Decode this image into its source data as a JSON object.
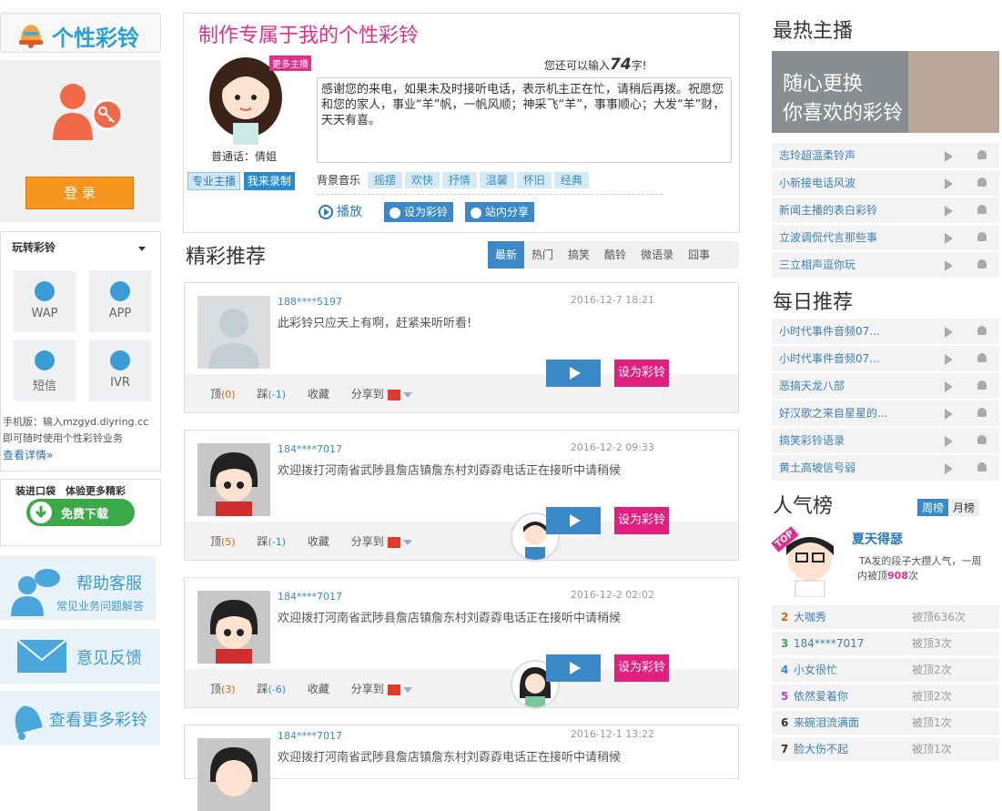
{
  "brand": {
    "title": "个性彩铃"
  },
  "left": {
    "login": "登 录",
    "play_title": "玩转彩铃",
    "channels": [
      "WAP",
      "APP",
      "短信",
      "IVR"
    ],
    "mobile_line1": "手机版：输入mzgyd.diyring.cc",
    "mobile_line2": "即可随时使用个性彩铃业务",
    "detail_link": "查看详情»",
    "pocket": "装进口袋　体验更多精彩",
    "download": "免费下载",
    "help_title": "帮助客服",
    "help_sub": "常见业务问题解答",
    "feedback": "意见反馈",
    "more": "查看更多彩铃"
  },
  "maker": {
    "title": "制作专属于我的个性彩铃",
    "more_anchor": "更多主播",
    "anchor_caption": "普通话：倩姐",
    "remain_prefix": "您还可以输入",
    "remain_count": "74",
    "remain_suffix": "字!",
    "text": "感谢您的来电，如果未及时接听电话，表示机主正在忙，请稍后再拨。祝愿您和您的家人，事业“羊”帆，一帆风顺；神采飞“羊”，事事顺心；大发“羊”财，天天有喜。",
    "tab_pro": "专业主播",
    "tab_self": "我来录制",
    "bg_label": "背景音乐",
    "bg_tags": [
      "摇摆",
      "欢快",
      "抒情",
      "温馨",
      "怀旧",
      "经典"
    ],
    "play": "播放",
    "set_ring": "设为彩铃",
    "share": "站内分享"
  },
  "recommend": {
    "title": "精彩推荐",
    "tabs": [
      "最新",
      "热门",
      "搞笑",
      "酷铃",
      "微语录",
      "囧事"
    ],
    "cards": [
      {
        "user": "188****5197",
        "time": "2016-12-7 18:21",
        "msg": "此彩铃只应天上有啊，赶紧来听听看!",
        "up": "顶",
        "up_n": "(0)",
        "down": "踩",
        "down_n": "(-1)",
        "fav": "收藏",
        "share": "分享到",
        "set": "设为彩铃"
      },
      {
        "user": "184****7017",
        "time": "2016-12-2 09:33",
        "msg": "欢迎拨打河南省武陟县詹店镇詹东村刘孬孬电话正在接听中请稍候",
        "up": "顶",
        "up_n": "(5)",
        "down": "踩",
        "down_n": "(-1)",
        "fav": "收藏",
        "share": "分享到",
        "set": "设为彩铃"
      },
      {
        "user": "184****7017",
        "time": "2016-12-2 02:02",
        "msg": "欢迎拨打河南省武陟县詹店镇詹东村刘孬孬电话正在接听中请稍候",
        "up": "顶",
        "up_n": "(3)",
        "down": "踩",
        "down_n": "(-6)",
        "fav": "收藏",
        "share": "分享到",
        "set": "设为彩铃"
      },
      {
        "user": "184****7017",
        "time": "2016-12-1 13:22",
        "msg": "欢迎拨打河南省武陟县詹店镇詹东村刘孬孬电话正在接听中请稍候"
      }
    ]
  },
  "right": {
    "hot_title": "最热主播",
    "banner_line1": "随心更换",
    "banner_line2": "你喜欢的彩铃",
    "hot_list": [
      "志玲超温柔铃声",
      "小新接电话风波",
      "新闻主播的表白彩铃",
      "立波调侃代言那些事",
      "三立相声逗你玩"
    ],
    "daily_title": "每日推荐",
    "daily_list": [
      "小时代事件音频07...",
      "小时代事件音频07...",
      "恶搞天龙八部",
      "好汉歌之来自星星的...",
      "搞笑彩铃语录",
      "黄土高坡信号弱"
    ],
    "pop_title": "人气榜",
    "pop_tabs": [
      "周榜",
      "月榜"
    ],
    "top_badge": "TOP",
    "top_name": "夏天得瑟",
    "top_desc1": "TA发的段子大攒人气，一周",
    "top_desc2_prefix": "内被顶",
    "top_desc2_num": "908",
    "top_desc2_suffix": "次",
    "rank": [
      {
        "n": "2",
        "name": "大咖秀",
        "count": "被顶636次"
      },
      {
        "n": "3",
        "name": "184****7017",
        "count": "被顶3次"
      },
      {
        "n": "4",
        "name": "小女很忙",
        "count": "被顶2次"
      },
      {
        "n": "5",
        "name": "依然爱着你",
        "count": "被顶2次"
      },
      {
        "n": "6",
        "name": "来碗泪流满面",
        "count": "被顶1次"
      },
      {
        "n": "7",
        "name": "脸大伤不起",
        "count": "被顶1次"
      }
    ]
  },
  "colors": {
    "accent_pink": "#e01f7e",
    "accent_blue": "#3a88c8",
    "login_orange": "#f7941d"
  }
}
